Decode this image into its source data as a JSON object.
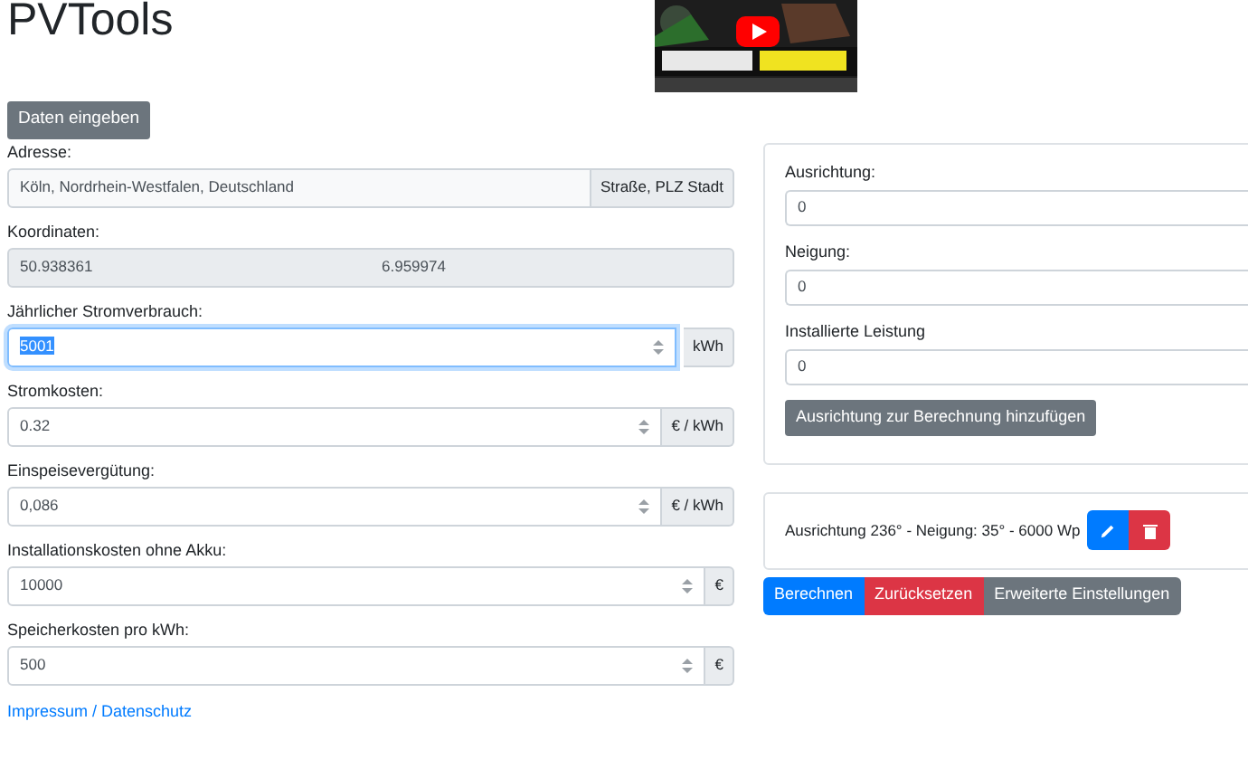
{
  "title": "PVTools",
  "enter_button": "Daten eingeben",
  "fields": [
    {
      "kind": "address",
      "label": "Adresse:",
      "value": "Köln, Nordrhein-Westfalen, Deutschland",
      "addon": "Straße, PLZ Stadt",
      "focused": false
    },
    {
      "kind": "coords",
      "label": "Koordinaten:",
      "values": [
        "50.938361",
        "6.959974"
      ]
    },
    {
      "kind": "number",
      "label": "Jährlicher Stromverbrauch:",
      "value": "5001",
      "addon": "kWh",
      "focused": true
    },
    {
      "kind": "number",
      "label": "Stromkosten:",
      "value": "0.32",
      "addon": "€ / kWh",
      "focused": false
    },
    {
      "kind": "number",
      "label": "Einspeisevergütung:",
      "value": "0,086",
      "addon": "€ / kWh",
      "focused": false
    },
    {
      "kind": "number",
      "label": "Installationskosten ohne Akku:",
      "value": "10000",
      "addon": "€",
      "focused": false
    },
    {
      "kind": "number",
      "label": "Speicherkosten pro kWh:",
      "value": "500",
      "addon": "€",
      "focused": false
    }
  ],
  "footer_link": "Impressum / Datenschutz",
  "orientation_panel": {
    "fields": [
      {
        "label": "Ausrichtung:",
        "value": "0"
      },
      {
        "label": "Neigung:",
        "value": "0"
      },
      {
        "label": "Installierte Leistung",
        "value": "0"
      }
    ],
    "add_button": "Ausrichtung zur Berechnung hinzufügen"
  },
  "entries": [
    {
      "text": "Ausrichtung 236° - Neigung: 35° - 6000 Wp"
    }
  ],
  "actions": [
    {
      "kind": "primary",
      "label": "Berechnen"
    },
    {
      "kind": "danger",
      "label": "Zurücksetzen"
    },
    {
      "kind": "secondary",
      "label": "Erweiterte Einstellungen"
    }
  ]
}
